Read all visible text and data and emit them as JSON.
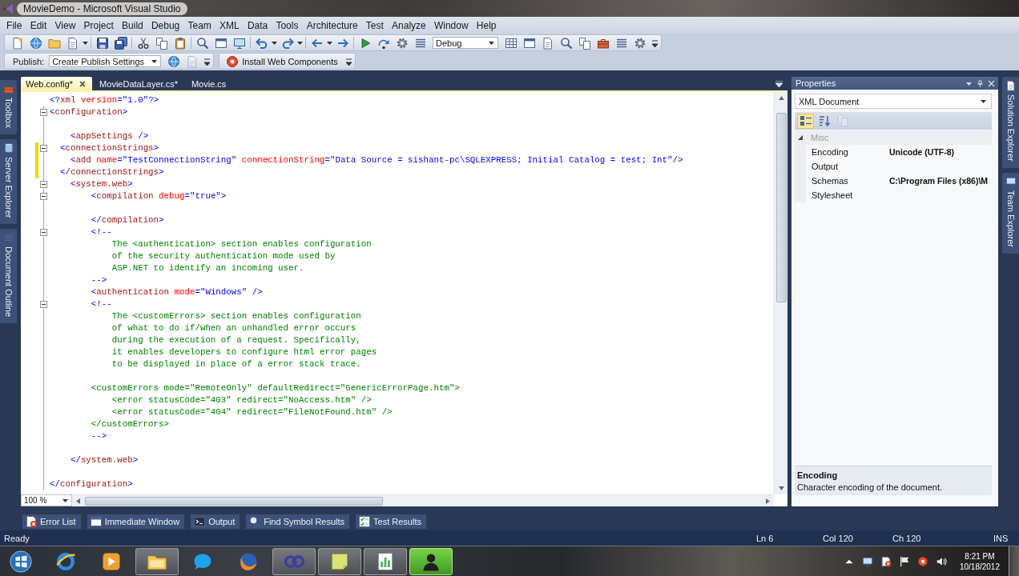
{
  "window": {
    "title": "MovieDemo - Microsoft Visual Studio"
  },
  "menu_bar": {
    "items": [
      "File",
      "Edit",
      "View",
      "Project",
      "Build",
      "Debug",
      "Team",
      "XML",
      "Data",
      "Tools",
      "Architecture",
      "Test",
      "Analyze",
      "Window",
      "Help"
    ]
  },
  "standard_toolbar": {
    "configuration": "Debug"
  },
  "publish_toolbar": {
    "label": "Publish:",
    "profile": "Create Publish Settings",
    "install_button": "Install Web Components"
  },
  "left_dock_tabs": [
    "Toolbox",
    "Server Explorer",
    "Document Outline"
  ],
  "document_tabs": [
    {
      "label": "Web.config*",
      "selected": true
    },
    {
      "label": "MovieDataLayer.cs*",
      "selected": false
    },
    {
      "label": "Movie.cs",
      "selected": false
    }
  ],
  "editor": {
    "zoom": "100 %",
    "lines": [
      {
        "modified": false,
        "foldable": false,
        "tokens": [
          {
            "kind": "delimiter",
            "text": "<?"
          },
          {
            "kind": "tag",
            "text": "xml"
          },
          {
            "kind": "attr",
            "text": " version"
          },
          {
            "kind": "value",
            "text": "=\"1.0\""
          },
          {
            "kind": "delimiter",
            "text": "?>"
          }
        ]
      },
      {
        "modified": false,
        "foldable": true,
        "tokens": [
          {
            "kind": "delimiter",
            "text": "<"
          },
          {
            "kind": "tag",
            "text": "configuration"
          },
          {
            "kind": "delimiter",
            "text": ">"
          }
        ]
      },
      {
        "modified": false,
        "foldable": false
      },
      {
        "modified": false,
        "foldable": false,
        "tokens": [
          {
            "kind": "delimiter",
            "text": "    <"
          },
          {
            "kind": "tag",
            "text": "appSettings"
          },
          {
            "kind": "delimiter",
            "text": " />"
          }
        ]
      },
      {
        "modified": true,
        "foldable": true,
        "tokens": [
          {
            "kind": "delimiter",
            "text": "  <"
          },
          {
            "kind": "tag",
            "text": "connectionStrings"
          },
          {
            "kind": "delimiter",
            "text": ">"
          }
        ]
      },
      {
        "modified": true,
        "foldable": false,
        "tokens": [
          {
            "kind": "delimiter",
            "text": "    <"
          },
          {
            "kind": "tag",
            "text": "add"
          },
          {
            "kind": "attr",
            "text": " name"
          },
          {
            "kind": "value",
            "text": "=\"TestConnectionString\""
          },
          {
            "kind": "attr",
            "text": " connectionString"
          },
          {
            "kind": "value",
            "text": "=\"Data Source = sishant-pc\\SQLEXPRESS; Initial Catalog = test; Int\""
          },
          {
            "kind": "delimiter",
            "text": "/>"
          }
        ]
      },
      {
        "modified": true,
        "foldable": false,
        "tokens": [
          {
            "kind": "delimiter",
            "text": "  </"
          },
          {
            "kind": "tag",
            "text": "connectionStrings"
          },
          {
            "kind": "delimiter",
            "text": ">"
          }
        ]
      },
      {
        "modified": false,
        "foldable": true,
        "tokens": [
          {
            "kind": "delimiter",
            "text": "    <"
          },
          {
            "kind": "tag",
            "text": "system.web"
          },
          {
            "kind": "delimiter",
            "text": ">"
          }
        ]
      },
      {
        "modified": false,
        "foldable": true,
        "tokens": [
          {
            "kind": "delimiter",
            "text": "        <"
          },
          {
            "kind": "tag",
            "text": "compilation"
          },
          {
            "kind": "attr",
            "text": " debug"
          },
          {
            "kind": "value",
            "text": "=\"true\""
          },
          {
            "kind": "delimiter",
            "text": ">"
          }
        ]
      },
      {
        "modified": false,
        "foldable": false
      },
      {
        "modified": false,
        "foldable": false,
        "tokens": [
          {
            "kind": "delimiter",
            "text": "        </"
          },
          {
            "kind": "tag",
            "text": "compilation"
          },
          {
            "kind": "delimiter",
            "text": ">"
          }
        ]
      },
      {
        "modified": false,
        "foldable": true,
        "tokens": [
          {
            "kind": "delimiter",
            "text": "        <!--"
          }
        ]
      },
      {
        "modified": false,
        "foldable": false,
        "tokens": [
          {
            "kind": "comment",
            "text": "            The <authentication> section enables configuration"
          }
        ]
      },
      {
        "modified": false,
        "foldable": false,
        "tokens": [
          {
            "kind": "comment",
            "text": "            of the security authentication mode used by"
          }
        ]
      },
      {
        "modified": false,
        "foldable": false,
        "tokens": [
          {
            "kind": "comment",
            "text": "            ASP.NET to identify an incoming user."
          }
        ]
      },
      {
        "modified": false,
        "foldable": false,
        "tokens": [
          {
            "kind": "delimiter",
            "text": "        -->"
          }
        ]
      },
      {
        "modified": false,
        "foldable": false,
        "tokens": [
          {
            "kind": "delimiter",
            "text": "        <"
          },
          {
            "kind": "tag",
            "text": "authentication"
          },
          {
            "kind": "attr",
            "text": " mode"
          },
          {
            "kind": "value",
            "text": "=\"Windows\""
          },
          {
            "kind": "delimiter",
            "text": " />"
          }
        ]
      },
      {
        "modified": false,
        "foldable": true,
        "tokens": [
          {
            "kind": "delimiter",
            "text": "        <!--"
          }
        ]
      },
      {
        "modified": false,
        "foldable": false,
        "tokens": [
          {
            "kind": "comment",
            "text": "            The <customErrors> section enables configuration"
          }
        ]
      },
      {
        "modified": false,
        "foldable": false,
        "tokens": [
          {
            "kind": "comment",
            "text": "            of what to do if/when an unhandled error occurs"
          }
        ]
      },
      {
        "modified": false,
        "foldable": false,
        "tokens": [
          {
            "kind": "comment",
            "text": "            during the execution of a request. Specifically,"
          }
        ]
      },
      {
        "modified": false,
        "foldable": false,
        "tokens": [
          {
            "kind": "comment",
            "text": "            it enables developers to configure html error pages"
          }
        ]
      },
      {
        "modified": false,
        "foldable": false,
        "tokens": [
          {
            "kind": "comment",
            "text": "            to be displayed in place of a error stack trace."
          }
        ]
      },
      {
        "modified": false,
        "foldable": false
      },
      {
        "modified": false,
        "foldable": false,
        "tokens": [
          {
            "kind": "comment",
            "text": "        <customErrors mode=\"RemoteOnly\" defaultRedirect=\"GenericErrorPage.htm\">"
          }
        ]
      },
      {
        "modified": false,
        "foldable": false,
        "tokens": [
          {
            "kind": "comment",
            "text": "            <error statusCode=\"403\" redirect=\"NoAccess.htm\" />"
          }
        ]
      },
      {
        "modified": false,
        "foldable": false,
        "tokens": [
          {
            "kind": "comment",
            "text": "            <error statusCode=\"404\" redirect=\"FileNotFound.htm\" />"
          }
        ]
      },
      {
        "modified": false,
        "foldable": false,
        "tokens": [
          {
            "kind": "comment",
            "text": "        </customErrors>"
          }
        ]
      },
      {
        "modified": false,
        "foldable": false,
        "tokens": [
          {
            "kind": "delimiter",
            "text": "        -->"
          }
        ]
      },
      {
        "modified": false,
        "foldable": false
      },
      {
        "modified": false,
        "foldable": false,
        "tokens": [
          {
            "kind": "delimiter",
            "text": "    </"
          },
          {
            "kind": "tag",
            "text": "system.web"
          },
          {
            "kind": "delimiter",
            "text": ">"
          }
        ]
      },
      {
        "modified": false,
        "foldable": false
      },
      {
        "modified": false,
        "foldable": false,
        "tokens": [
          {
            "kind": "delimiter",
            "text": "</"
          },
          {
            "kind": "tag",
            "text": "configuration"
          },
          {
            "kind": "delimiter",
            "text": ">"
          }
        ]
      }
    ]
  },
  "properties": {
    "title": "Properties",
    "object": "XML Document",
    "toolbar_buttons": [
      {
        "selected": true,
        "disabled": false
      },
      {
        "selected": false,
        "disabled": false
      },
      {
        "selected": false,
        "disabled": true
      }
    ],
    "category": {
      "name": "Misc",
      "expanded": true
    },
    "rows": [
      {
        "name": "Encoding",
        "value": "Unicode (UTF-8)"
      },
      {
        "name": "Output"
      },
      {
        "name": "Schemas",
        "value": "C:\\Program Files (x86)\\M"
      },
      {
        "name": "Stylesheet"
      }
    ],
    "description": {
      "title": "Encoding",
      "text": "Character encoding of the document."
    }
  },
  "right_dock_tabs": [
    "Solution Explorer",
    "Team Explorer"
  ],
  "tool_tabs": [
    "Error List",
    "Immediate Window",
    "Output",
    "Find Symbol Results",
    "Test Results"
  ],
  "status_bar": {
    "message": "Ready",
    "line": "Ln 6",
    "column": "Col 120",
    "character": "Ch 120",
    "mode": "INS"
  },
  "taskbar": {
    "apps": [
      {
        "open": false,
        "selected": false
      },
      {
        "open": false,
        "selected": false
      },
      {
        "open": true,
        "selected": false
      },
      {
        "open": false,
        "selected": false
      },
      {
        "open": false,
        "selected": false
      },
      {
        "open": true,
        "selected": false
      },
      {
        "open": true,
        "selected": false
      },
      {
        "open": true,
        "selected": false
      },
      {
        "open": true,
        "selected": true
      }
    ],
    "time": "8:21 PM",
    "date": "10/18/2012"
  }
}
